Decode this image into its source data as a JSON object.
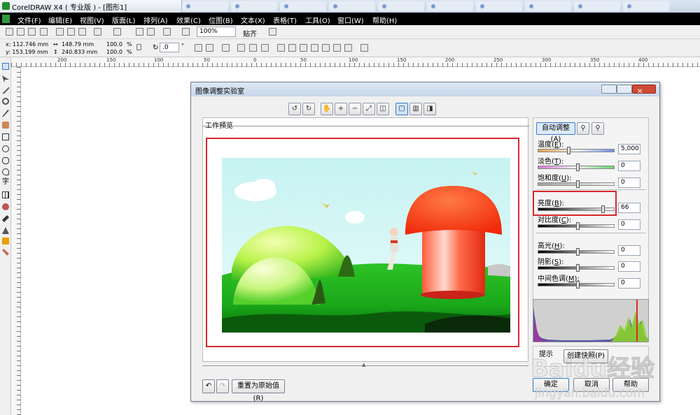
{
  "app": {
    "title": "CorelDRAW X4 ( 专业版 ) - [图形1]",
    "menu": [
      "文件(F)",
      "编辑(E)",
      "视图(V)",
      "版面(L)",
      "排列(A)",
      "效果(C)",
      "位图(B)",
      "文本(X)",
      "表格(T)",
      "工具(O)",
      "窗口(W)",
      "帮助(H)"
    ]
  },
  "toolbar": {
    "zoom": "100%",
    "snap": "贴齐"
  },
  "propbar": {
    "x": "x: 112.746 mm",
    "y": "y: 153.199 mm",
    "w": "148.79 mm",
    "h": "240.833 mm",
    "sx": "100.0",
    "sy": "100.0",
    "pct": "%",
    "rotate": ".0",
    "deg": "°"
  },
  "ruler": {
    "ticks": [
      "200",
      "150",
      "100",
      "50",
      "0",
      "50",
      "100",
      "150",
      "200",
      "250",
      "300",
      "350",
      "400"
    ]
  },
  "dialog": {
    "title": "图像调整实验室",
    "preview_label": "工作预览",
    "auto_adjust": "自动调整(A)",
    "reset": "重置为原始值(R)",
    "hint_label": "提示",
    "snapshot": "创建快照(P)",
    "ok": "确定",
    "cancel": "取消",
    "help": "帮助"
  },
  "sliders": [
    {
      "label": "温度",
      "key": "E",
      "value": "5,000",
      "fraction": 0.38,
      "gradient": "linear-gradient(90deg,#e8a145,#f2f2f2,#6c8fe8)"
    },
    {
      "label": "淡色",
      "key": "T",
      "value": "0",
      "fraction": 0.5,
      "gradient": "linear-gradient(90deg,#d774d8,#f2f2f2,#67d46a)"
    },
    {
      "label": "饱和度",
      "key": "U",
      "value": "0",
      "fraction": 0.5,
      "gradient": "linear-gradient(90deg,#a0a0a0,#f2f2f2)"
    },
    {
      "label": "亮度",
      "key": "B",
      "value": "66",
      "fraction": 0.83,
      "gradient": "linear-gradient(90deg,#000,#fff)"
    },
    {
      "label": "对比度",
      "key": "C",
      "value": "0",
      "fraction": 0.5,
      "gradient": "linear-gradient(90deg,#000,#fff)"
    },
    {
      "label": "高光",
      "key": "H",
      "value": "0",
      "fraction": 0.5,
      "gradient": "linear-gradient(90deg,#000,#fff)"
    },
    {
      "label": "阴影",
      "key": "S",
      "value": "0",
      "fraction": 0.5,
      "gradient": "linear-gradient(90deg,#000,#fff)"
    },
    {
      "label": "中间色调",
      "key": "M",
      "value": "0",
      "fraction": 0.5,
      "gradient": "linear-gradient(90deg,#000,#fff)"
    }
  ],
  "colors": {
    "highlight": "#d8262c",
    "titlebar": "#c7d6ea"
  },
  "watermark": {
    "text": "Baidu经验",
    "url": "jingyan.baidu.com"
  }
}
